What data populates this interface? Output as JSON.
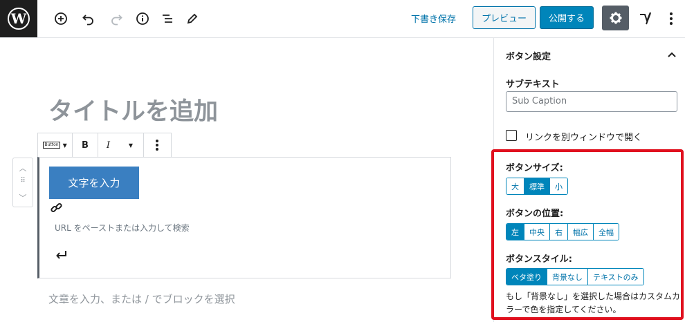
{
  "topbar": {
    "logo_icon": "wordpress-logo",
    "tools": [
      "add-block-icon",
      "undo-icon",
      "redo-icon",
      "info-icon",
      "outline-icon",
      "edit-tools-icon"
    ],
    "save_draft": "下書き保存",
    "preview": "プレビュー",
    "publish": "公開する",
    "settings_icon": "gear-icon",
    "plugin_icon": "yoast-icon",
    "more_icon": "more-vertical-icon"
  },
  "editor": {
    "title_placeholder": "タイトルを追加",
    "block_toolbar": {
      "block_type_label": "Button",
      "bold": "B",
      "italic": "I"
    },
    "button_text": "文字を入力",
    "url_placeholder": "URL をペーストまたは入力して検索",
    "paragraph_placeholder": "文章を入力、または / でブロックを選択"
  },
  "sidebar": {
    "panel_title": "ボタン設定",
    "subtext_label": "サブテキスト",
    "subtext_placeholder": "Sub Caption",
    "new_window_label": "リンクを別ウィンドウで開く",
    "size_label": "ボタンサイズ:",
    "size_options": [
      "大",
      "標準",
      "小"
    ],
    "size_selected": "標準",
    "position_label": "ボタンの位置:",
    "position_options": [
      "左",
      "中央",
      "右",
      "幅広",
      "全幅"
    ],
    "position_selected": "左",
    "style_label": "ボタンスタイル:",
    "style_options": [
      "ベタ塗り",
      "背景なし",
      "テキストのみ"
    ],
    "style_selected": "ベタ塗り",
    "note": "もし「背景なし」を選択した場合はカスタムカラーで色を指定してください。"
  },
  "colors": {
    "accent": "#0085ba",
    "button_fill": "#3a7fc1",
    "highlight": "#e0101e"
  }
}
